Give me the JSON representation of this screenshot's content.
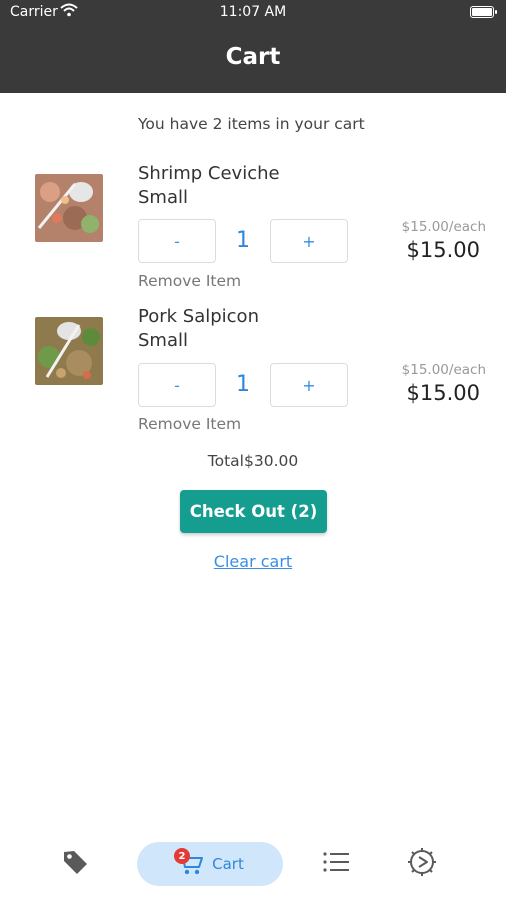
{
  "status_bar": {
    "carrier": "Carrier",
    "time": "11:07 AM"
  },
  "header": {
    "title": "Cart"
  },
  "summary_text": "You have 2 items in your cart",
  "items": [
    {
      "name": "Shrimp Ceviche",
      "size": "Small",
      "decrement_label": "-",
      "quantity": "1",
      "increment_label": "+",
      "remove_label": "Remove Item",
      "unit_price": "$15.00/each",
      "price": "$15.00"
    },
    {
      "name": "Pork Salpicon",
      "size": "Small",
      "decrement_label": "-",
      "quantity": "1",
      "increment_label": "+",
      "remove_label": "Remove Item",
      "unit_price": "$15.00/each",
      "price": "$15.00"
    }
  ],
  "total_text": "Total$30.00",
  "checkout_label": "Check Out (2)",
  "clear_label": "Clear cart",
  "tabbar": {
    "cart_label": "Cart",
    "cart_badge": "2",
    "icons": [
      "tag-icon",
      "cart-icon",
      "list-icon",
      "settings-icon"
    ]
  },
  "colors": {
    "header_bg": "#3a3a3a",
    "accent_teal": "#159d8f",
    "link_blue": "#3a8ee6",
    "tab_active_bg": "#cfe6fb",
    "badge_red": "#e53935"
  }
}
